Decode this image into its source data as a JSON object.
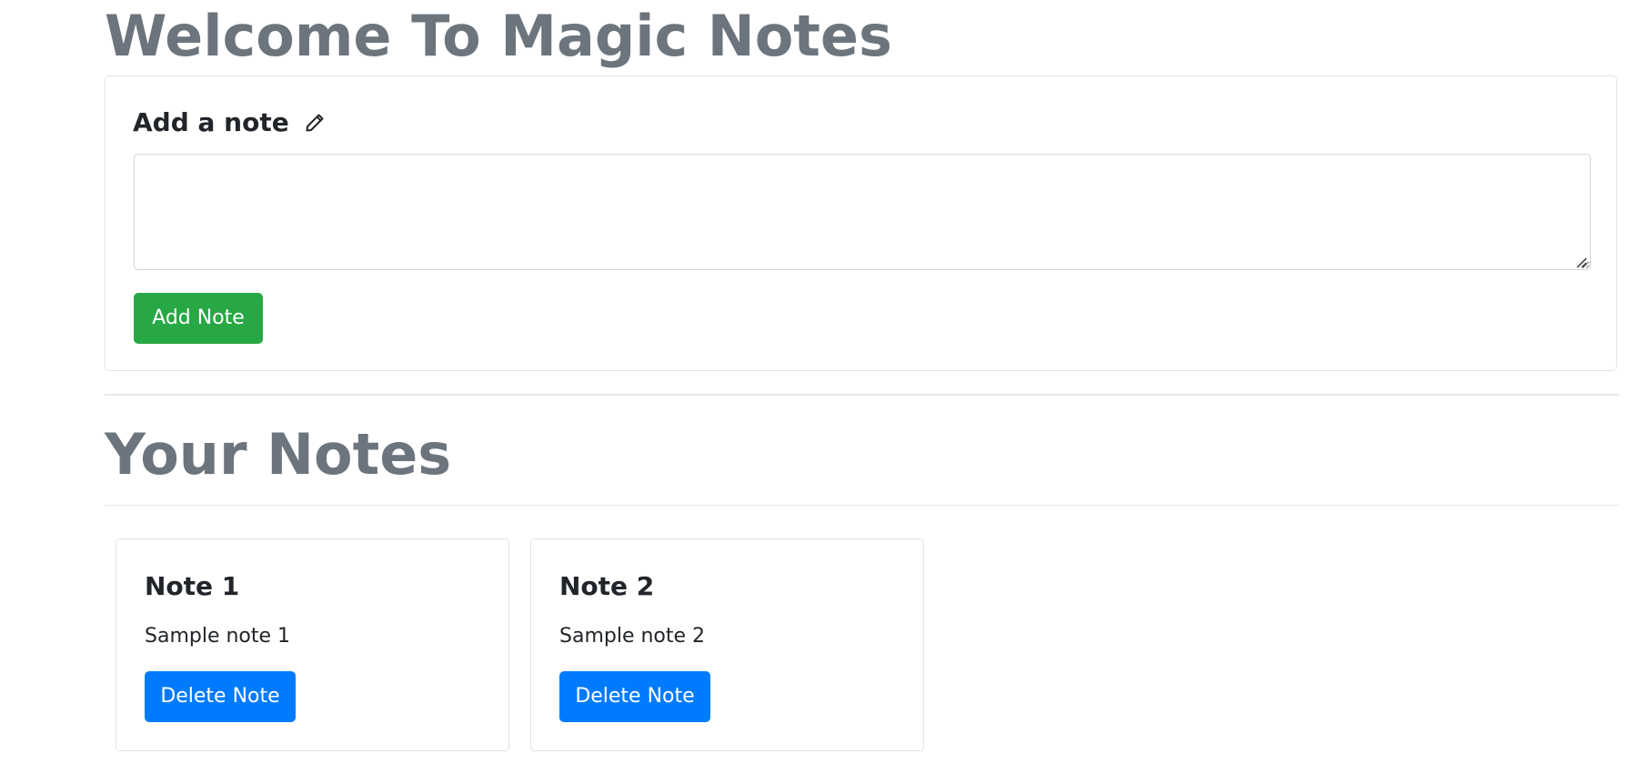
{
  "page": {
    "title": "Welcome To Magic Notes"
  },
  "add_note": {
    "heading": "Add a note",
    "icon": "pencil-icon",
    "textarea_value": "",
    "button_label": "Add Note"
  },
  "notes_section": {
    "title": "Your Notes"
  },
  "notes": [
    {
      "title": "Note 1",
      "text": "Sample note 1",
      "delete_label": "Delete Note"
    },
    {
      "title": "Note 2",
      "text": "Sample note 2",
      "delete_label": "Delete Note"
    }
  ],
  "colors": {
    "heading_gray": "#6c757d",
    "success": "#28a745",
    "primary": "#007bff",
    "border": "#dfe2e5"
  }
}
